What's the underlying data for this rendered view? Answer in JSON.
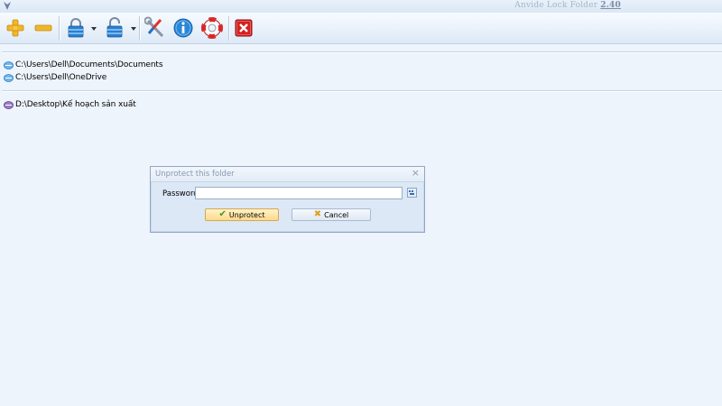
{
  "window": {
    "title": "Anvide Lock Folder",
    "version": "2.40"
  },
  "toolbar": {
    "buttons": [
      {
        "name": "add-folder-button",
        "icon": "plus-icon"
      },
      {
        "name": "remove-folder-button",
        "icon": "minus-icon"
      },
      {
        "name": "lock-button",
        "icon": "closed-padlock-icon"
      },
      {
        "name": "unlock-button",
        "icon": "open-padlock-icon"
      },
      {
        "name": "settings-button",
        "icon": "wrench-screwdriver-icon"
      },
      {
        "name": "about-button",
        "icon": "info-icon"
      },
      {
        "name": "help-button",
        "icon": "lifebuoy-icon"
      },
      {
        "name": "exit-button",
        "icon": "close-icon"
      }
    ]
  },
  "folders": {
    "group1": [
      {
        "path": "C:\\Users\\Dell\\Documents\\Documents",
        "icon": "folder-unlocked-icon"
      },
      {
        "path": "C:\\Users\\Dell\\OneDrive",
        "icon": "folder-unlocked-icon"
      }
    ],
    "group2": [
      {
        "path": "D:\\Desktop\\Kế hoạch sản xuất",
        "icon": "folder-locked-icon"
      }
    ]
  },
  "dialog": {
    "title": "Unprotect this folder",
    "close_glyph": "×",
    "password_label": "Password",
    "password_value": "",
    "ok_label": "Unprotect",
    "cancel_label": "Cancel"
  },
  "colors": {
    "background": "#eef4fc",
    "accent": "#1e78c8",
    "ok_button": "#ffd98a",
    "exit_red": "#d42020"
  }
}
